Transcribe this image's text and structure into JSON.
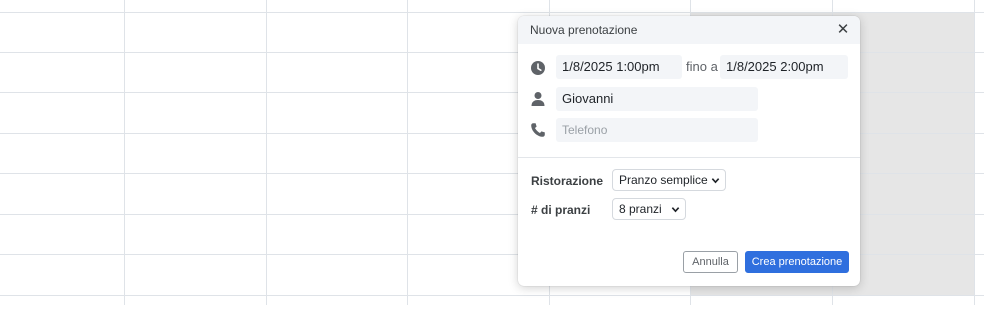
{
  "popup": {
    "title": "Nuova prenotazione",
    "close_icon": "close-icon",
    "start_datetime": "1/8/2025 1:00pm",
    "to_label": "fino a",
    "end_datetime": "1/8/2025 2:00pm",
    "name_value": "Giovanni",
    "phone_placeholder": "Telefono",
    "catering_label": "Ristorazione",
    "catering_selected": "Pranzo semplice",
    "lunches_label": "# di pranzi",
    "lunches_selected": "8 pranzi",
    "cancel_label": "Annulla",
    "create_label": "Crea prenotazione"
  },
  "icons": [
    "clock-icon",
    "person-icon",
    "phone-icon",
    "chevron-down-icon"
  ],
  "colors": {
    "primary": "#2f6fde",
    "field_bg": "#f3f5f8",
    "grid_line": "#dfe3e8",
    "shaded_column": "#e6e6e6"
  }
}
